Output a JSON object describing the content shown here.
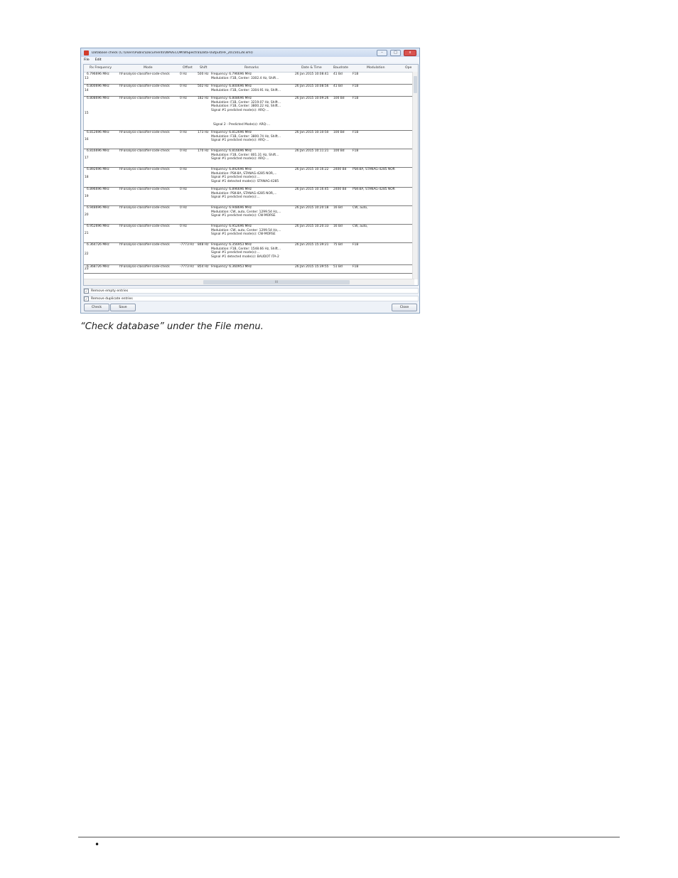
{
  "window": {
    "title": "Database check (C:\\Users\\Public\\Documents\\WAVECOM\\WSpectra\\Data-Output\\HF_20150128.xml)",
    "minimize": "–",
    "maximize": "□",
    "close": "x"
  },
  "menu": {
    "file": "File",
    "edit": "Edit"
  },
  "headers": {
    "rx_frequency": "Rx Frequency",
    "mode": "Mode",
    "offset": "Offset",
    "shift": "Shift",
    "remarks": "Remarks",
    "datetime": "Date & Time",
    "baudrate": "Baudrate",
    "modulation": "Modulation",
    "ope": "Ope"
  },
  "rows": [
    {
      "num": "13",
      "freq": "6.796696 MHz",
      "mode": "hf-analysis-classifier-code-check",
      "offset": "0 Hz",
      "shift": "500 Hz",
      "r1": "Frequency: 6.796696 MHz",
      "r2": "Modulation: F1B, Center: 3302.4 Hz, Shift...",
      "r3": "",
      "r4": "",
      "r5": "",
      "date": "26 Jan 2015 10:08:41",
      "baud": "41 Bd",
      "modu": "F1B"
    },
    {
      "num": "14",
      "freq": "6.800696 MHz",
      "mode": "hf-analysis-classifier-code-check",
      "offset": "0 Hz",
      "shift": "502 Hz",
      "r1": "Frequency: 6.800696 MHz",
      "r2": "Modulation: F1B, Center: 3304.91 Hz, Shift...",
      "r3": "",
      "r4": "",
      "r5": "",
      "date": "26 Jan 2015 10:08:56",
      "baud": "41 Bd",
      "modu": "F1B"
    },
    {
      "num": "15",
      "freq": "6.808696 MHz",
      "mode": "hf-analysis-classifier-code-check",
      "offset": "0 Hz",
      "shift": "182 Hz",
      "r1": "Frequency: 6.808696 MHz",
      "r2": "Modulation: F1B, Center: 3219.07 Hz, Shift...",
      "r3": "Modulation: F1B, Center: 3800.22 Hz, Shift...",
      "r4": "Signal #1 predicted mode(s): ARQ-...",
      "r5": "Signal 2 - Predicted Mode(s): ARQ-...",
      "date": "26 Jan 2015 10:09:26",
      "baud": "100 Bd",
      "modu": "F1B"
    },
    {
      "num": "16",
      "freq": "6.812696 MHz",
      "mode": "hf-analysis-classifier-code-check",
      "offset": "0 Hz",
      "shift": "173 Hz",
      "r1": "Frequency: 6.812696 MHz",
      "r2": "Modulation: F1B, Center: 3800.74 Hz, Shift...",
      "r3": "Signal #1 predicted mode(s): ARQ-...",
      "r4": "",
      "r5": "",
      "date": "26 Jan 2015 10:10:50",
      "baud": "100 Bd",
      "modu": "F1B"
    },
    {
      "num": "17",
      "freq": "6.816696 MHz",
      "mode": "hf-analysis-classifier-code-check",
      "offset": "0 Hz",
      "shift": "170 Hz",
      "r1": "Frequency: 6.816696 MHz",
      "r2": "Modulation: F1B, Center: 801.31 Hz, Shift...",
      "r3": "Signal #1 predicted mode(s): ARQ-...",
      "r4": "",
      "r5": "",
      "date": "26 Jan 2015 10:11:21",
      "baud": "100 Bd",
      "modu": "F1B"
    },
    {
      "num": "18",
      "freq": "6.892696 MHz",
      "mode": "hf-analysis-classifier-code-check",
      "offset": "0 Hz",
      "shift": "",
      "r1": "Frequency: 6.892696 MHz",
      "r2": "Modulation: PSK-8A, STANAG-4285 NOR,...",
      "r3": "Signal #1 predicted mode(s):...",
      "r4": "Signal #1 detected mode(s): STANAG-4285",
      "r5": "",
      "date": "26 Jan 2015 10:16:22",
      "baud": "2400 Bd",
      "modu": "PSK-8A, STANAG-4285 NOR"
    },
    {
      "num": "19",
      "freq": "6.896696 MHz",
      "mode": "hf-analysis-classifier-code-check",
      "offset": "0 Hz",
      "shift": "",
      "r1": "Frequency: 6.896696 MHz",
      "r2": "Modulation: PSK-8A, STANAG-4285 NOR,...",
      "r3": "Signal #1 predicted mode(s):...",
      "r4": "",
      "r5": "",
      "date": "26 Jan 2015 10:16:45",
      "baud": "2400 Bd",
      "modu": "PSK-8A, STANAG-4285 NOR"
    },
    {
      "num": "20",
      "freq": "6.948696 MHz",
      "mode": "hf-analysis-classifier-code-check",
      "offset": "0 Hz",
      "shift": "",
      "r1": "Frequency: 6.948696 MHz",
      "r2": "Modulation: CW, auto, Center: 1299.54 Hz,...",
      "r3": "Signal #1 predicted mode(s): CW-MORSE",
      "r4": "",
      "r5": "",
      "date": "26 Jan 2015 10:20:18",
      "baud": "16 Bd",
      "modu": "CW, auto,"
    },
    {
      "num": "21",
      "freq": "6.952696 MHz",
      "mode": "hf-analysis-classifier-code-check",
      "offset": "0 Hz",
      "shift": "",
      "r1": "Frequency: 6.952696 MHz",
      "r2": "Modulation: CW, auto, Center: 1299.54 Hz,...",
      "r3": "Signal #1 predicted mode(s): CW-MORSE",
      "r4": "",
      "r5": "",
      "date": "26 Jan 2015 10:20:33",
      "baud": "16 Bd",
      "modu": "CW, auto,"
    },
    {
      "num": "22",
      "freq": "6.364726 MHz",
      "mode": "hf-analysis-classifier-code-check",
      "offset": "-7773 Hz",
      "shift": "848 Hz",
      "r1": "Frequency: 6.356953 MHz",
      "r2": "Modulation: F1B, Center: 1548.66 Hz, Shift...",
      "r3": "Signal #1 predicted mode(s):...",
      "r4": "Signal #1 detected mode(s): BAUDOT ITA-2",
      "r5": "",
      "date": "26 Jan 2015 15:39:21",
      "baud": "75 Bd",
      "modu": "F1B"
    },
    {
      "num": "23",
      "freq": "6.368726 MHz",
      "mode": "hf-analysis-classifier-code-check",
      "offset": "-7773 Hz",
      "shift": "854 Hz",
      "r1": "Frequency: 6.360953 MHz",
      "r2": "",
      "r3": "",
      "r4": "",
      "r5": "",
      "date": "26 Jan 2015 15:39:55",
      "baud": "51 Bd",
      "modu": "F1B"
    }
  ],
  "scroll": {
    "hthumb": "III"
  },
  "options": {
    "remove_empty": "Remove empty entries",
    "remove_duplicate": "Remove duplicate entries",
    "check_mark": "✓"
  },
  "buttons": {
    "check": "Check",
    "save": "Save",
    "close": "Close"
  },
  "caption": "“Check database” under the File menu.",
  "footer": {
    "bullet": "•"
  }
}
